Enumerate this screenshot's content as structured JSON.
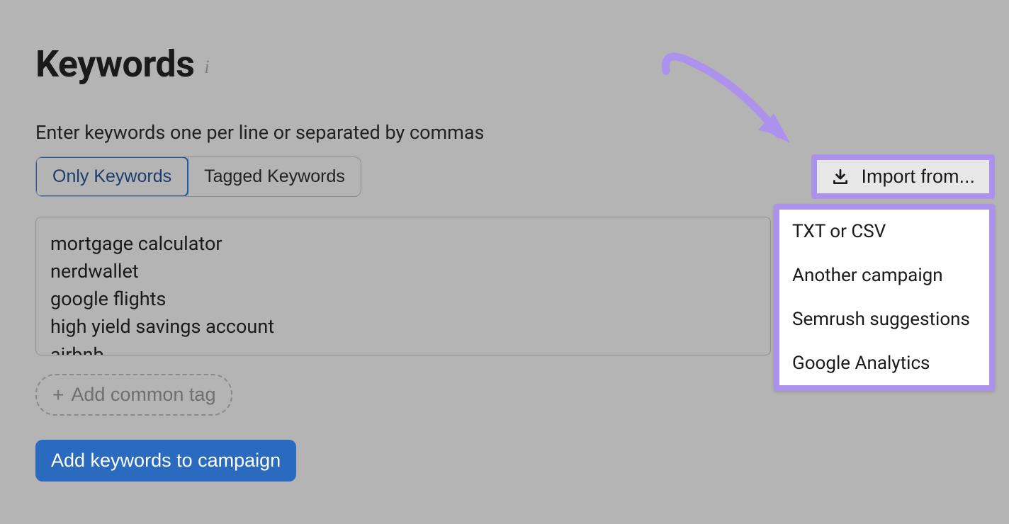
{
  "title": "Keywords",
  "subheading": "Enter keywords one per line or separated by commas",
  "tabs": {
    "only": "Only Keywords",
    "tagged": "Tagged Keywords"
  },
  "textarea_value": "mortgage calculator\nnerdwallet\ngoogle flights\nhigh yield savings account\nairbnb",
  "add_tag_label": "Add common tag",
  "submit_label": "Add keywords to campaign",
  "import": {
    "button_label": "Import from...",
    "options": [
      "TXT or CSV",
      "Another campaign",
      "Semrush suggestions",
      "Google Analytics"
    ]
  }
}
